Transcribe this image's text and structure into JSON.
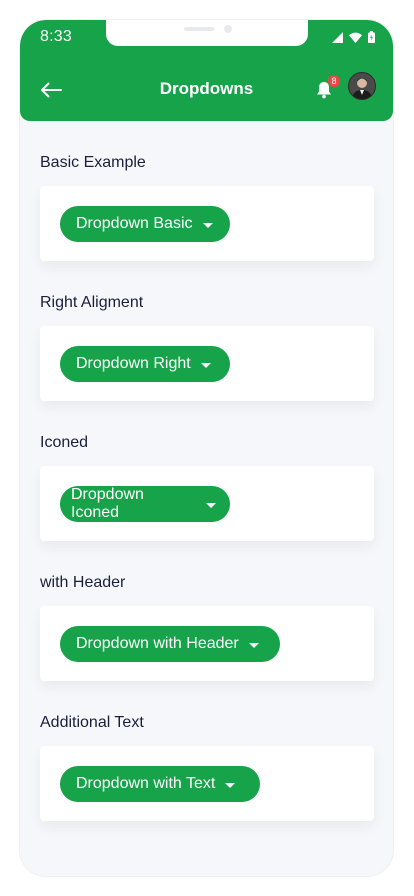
{
  "status_bar": {
    "time": "8:33",
    "icons": [
      "signal-icon",
      "wifi-icon",
      "battery-icon"
    ]
  },
  "header": {
    "title": "Dropdowns",
    "back_icon": "arrow-left-icon",
    "notification_icon": "bell-icon",
    "notification_count": "8",
    "avatar": "user-avatar"
  },
  "sections": [
    {
      "label": "Basic Example",
      "button": "Dropdown Basic"
    },
    {
      "label": "Right Aligment",
      "button": "Dropdown Right"
    },
    {
      "label": "Iconed",
      "button": "Dropdown Iconed"
    },
    {
      "label": "with Header",
      "button": "Dropdown with Header"
    },
    {
      "label": "Additional Text",
      "button": "Dropdown with Text"
    }
  ],
  "colors": {
    "primary": "#16a34a",
    "background": "#f6f7fa",
    "card": "#ffffff",
    "label_text": "#1b1f3b",
    "badge": "#ef4444"
  }
}
